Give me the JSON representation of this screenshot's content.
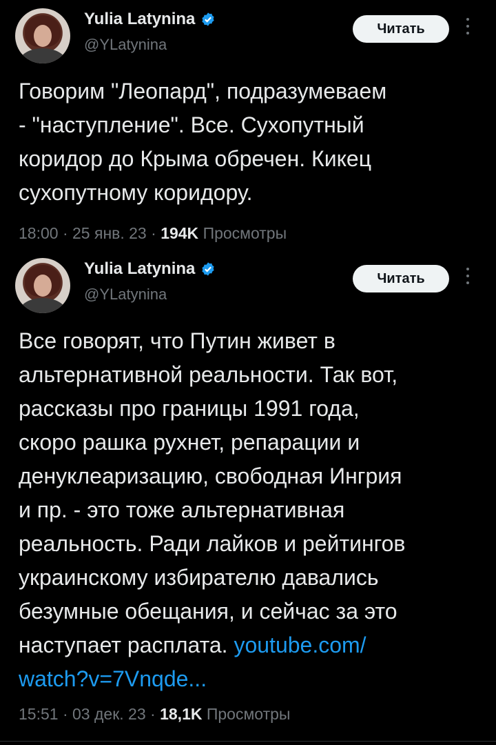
{
  "tweets": [
    {
      "author_name": "Yulia Latynina",
      "handle": "@YLatynina",
      "follow_label": "Читать",
      "text": "Говорим \"Леопард\", подразумеваем\n- \"наступление\".  Все. Сухопутный\nкоридор до Крыма обречен. Кикец\nсухопутному коридору.",
      "link": "",
      "time": "18:00",
      "date": "25 янв. 23",
      "views_count": "194K",
      "views_label": "Просмотры"
    },
    {
      "author_name": "Yulia Latynina",
      "handle": "@YLatynina",
      "follow_label": "Читать",
      "text": "Все говорят, что Путин живет в\nальтернативной реальности. Так вот,\nрассказы про границы 1991 года,\nскоро рашка рухнет, репарации и\nденуклеаризацию, свободная Ингрия\nи пр. - это тоже альтернативная\nреальность. Ради лайков и рейтингов\nукраинскому избирателю давались\nбезумные обещания, и сейчас за это\nнаступает расплата. ",
      "link": "youtube.com/\nwatch?v=7Vnqde...",
      "time": "15:51",
      "date": "03 дек. 23",
      "views_count": "18,1K",
      "views_label": "Просмотры"
    }
  ],
  "colors": {
    "background": "#000000",
    "text": "#e7e9ea",
    "secondary": "#71767b",
    "link": "#1d9bf0",
    "verified": "#1d9bf0"
  },
  "icons": {
    "verified": "verified-badge-icon",
    "more": "more-vertical-icon"
  }
}
